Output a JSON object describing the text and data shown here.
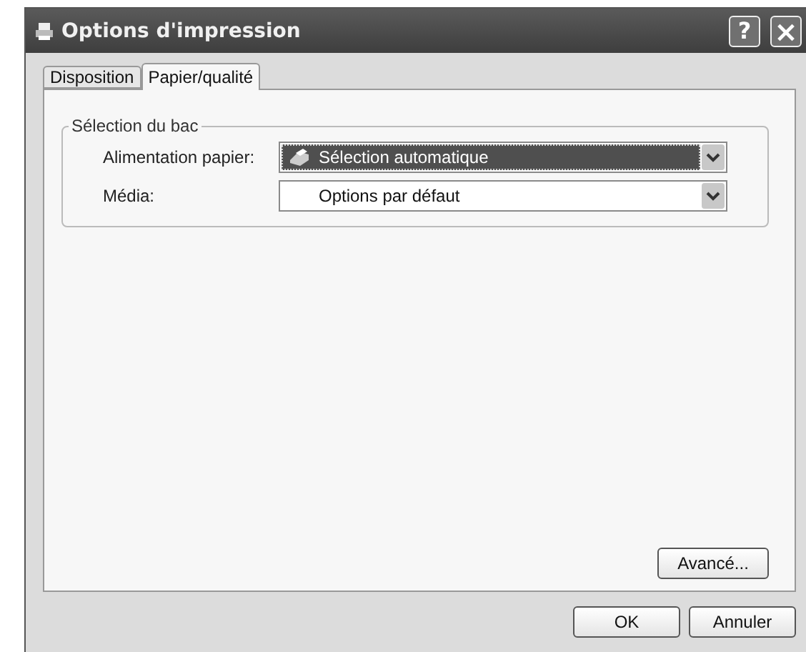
{
  "window": {
    "title": "Options d'impression",
    "buttons": [
      {
        "kind": "help",
        "label": "?"
      },
      {
        "kind": "close",
        "label": "×"
      }
    ]
  },
  "tabs": [
    {
      "label": "Disposition",
      "selected": false
    },
    {
      "label": "Papier/qualité",
      "selected": true
    }
  ],
  "group": {
    "title": "Sélection du bac",
    "fields": [
      {
        "label": "Alimentation papier:",
        "value": "Sélection automatique",
        "focused": true,
        "icon": true
      },
      {
        "label": "Média:",
        "value": "Options par défaut",
        "focused": false,
        "icon": false
      }
    ]
  },
  "advanced_button": "Avancé...",
  "buttons": [
    "OK",
    "Annuler"
  ]
}
